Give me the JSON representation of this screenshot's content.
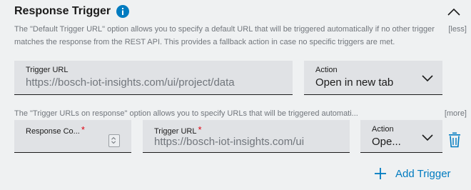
{
  "section": {
    "title": "Response Trigger",
    "default_description": "The \"Default Trigger URL\" option allows you to specify a default URL that will be triggered automatically if no other trigger matches the response from the REST API. This provides a fallback action in case no specific triggers are met.",
    "less_link": "[less]",
    "triggers_description": "The \"Trigger URLs on response\" option allows you to specify URLs that will be triggered automati...",
    "more_link": "[more]"
  },
  "default_trigger": {
    "url_label": "Trigger URL",
    "url_value": "https://bosch-iot-insights.com/ui/project/data",
    "action_label": "Action",
    "action_value": "Open in new tab"
  },
  "response_trigger": {
    "code_label": "Response Co...",
    "required_mark": "*",
    "url_label": "Trigger URL",
    "url_value": "https://bosch-iot-insights.com/ui",
    "action_label": "Action",
    "action_value": "Ope..."
  },
  "add_trigger": {
    "label": "Add Trigger"
  },
  "colors": {
    "accent": "#007bc0",
    "required": "#e0000f",
    "field_bg": "#e0e2e5",
    "page_bg": "#eff1f2",
    "muted_text": "#71767c"
  },
  "icons": {
    "info": "info-icon",
    "collapse": "chevron-up-icon",
    "dropdown": "chevron-down-icon",
    "stepper": "stepper-icon",
    "delete": "trash-icon",
    "add": "plus-icon"
  }
}
